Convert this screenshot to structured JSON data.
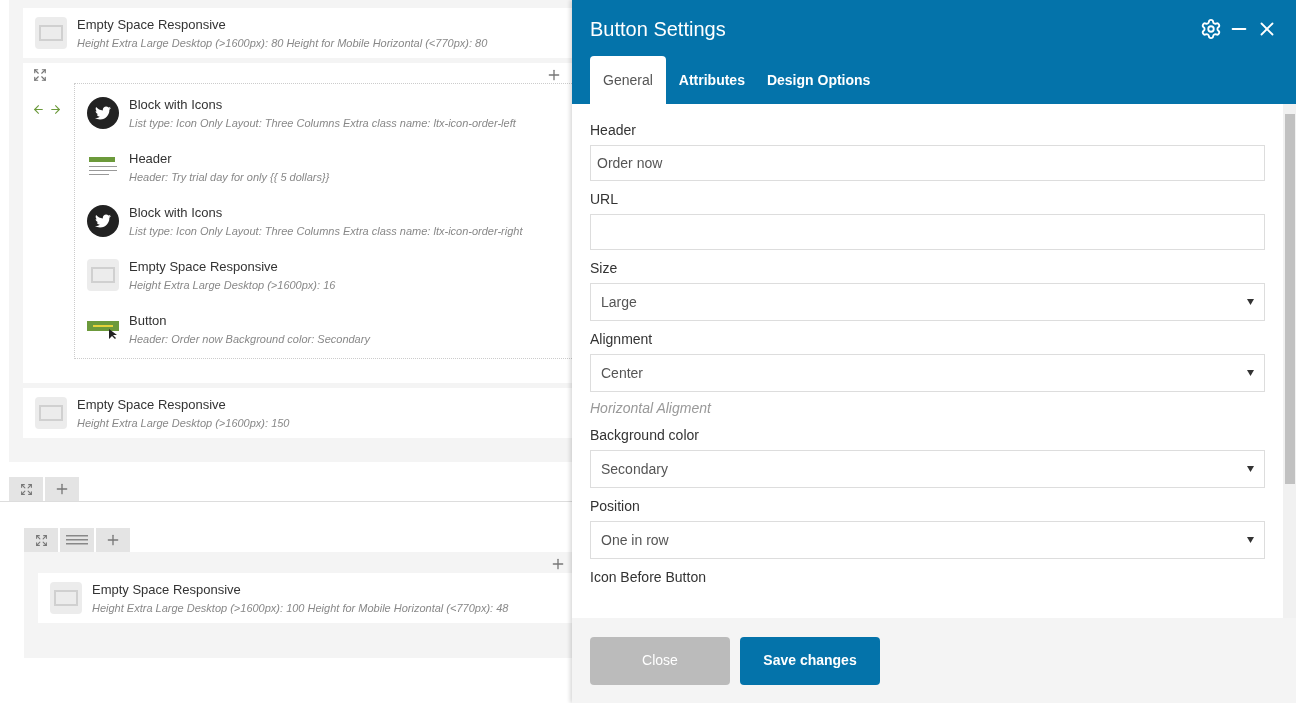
{
  "builder": {
    "top_element": {
      "kind": "empty",
      "title": "Empty Space Responsive",
      "desc": "Height Extra Large Desktop (>1600px): 80  Height for Mobile Horizontal (<770px): 80"
    },
    "row": {
      "items": [
        {
          "kind": "twitter",
          "title": "Block with Icons",
          "desc": "List type: Icon Only  Layout: Three Columns  Extra class name: ltx-icon-order-left"
        },
        {
          "kind": "header",
          "title": "Header",
          "desc": "Header: Try trial day for only {{ 5 dollars}}"
        },
        {
          "kind": "twitter",
          "title": "Block with Icons",
          "desc": "List type: Icon Only  Layout: Three Columns  Extra class name: ltx-icon-order-right"
        },
        {
          "kind": "empty",
          "title": "Empty Space Responsive",
          "desc": "Height Extra Large Desktop (>1600px): 16"
        },
        {
          "kind": "button",
          "title": "Button",
          "desc": "Header: Order now  Background color: Secondary"
        }
      ]
    },
    "bottom_element": {
      "kind": "empty",
      "title": "Empty Space Responsive",
      "desc": "Height Extra Large Desktop (>1600px): 150"
    },
    "nested_element": {
      "kind": "empty",
      "title": "Empty Space Responsive",
      "desc": "Height Extra Large Desktop (>1600px): 100  Height for Mobile Horizontal (<770px): 48"
    }
  },
  "modal": {
    "title": "Button Settings",
    "tabs": [
      {
        "label": "General",
        "selected": true
      },
      {
        "label": "Attributes",
        "selected": false
      },
      {
        "label": "Design Options",
        "selected": false
      }
    ],
    "fields": [
      {
        "kind": "text",
        "label": "Header",
        "value": "Order now"
      },
      {
        "kind": "text",
        "label": "URL"
      },
      {
        "kind": "select",
        "label": "Size",
        "value": "Large"
      },
      {
        "kind": "select",
        "label": "Alignment",
        "value": "Center",
        "hint": "Horizontal Aligment"
      },
      {
        "kind": "select",
        "label": "Background color",
        "value": "Secondary"
      },
      {
        "kind": "select",
        "label": "Position",
        "value": "One in row"
      },
      {
        "kind": "heading",
        "label": "Icon Before Button"
      }
    ],
    "buttons": [
      {
        "kind": "secondary",
        "label": "Close"
      },
      {
        "kind": "primary",
        "label": "Save changes"
      }
    ]
  }
}
